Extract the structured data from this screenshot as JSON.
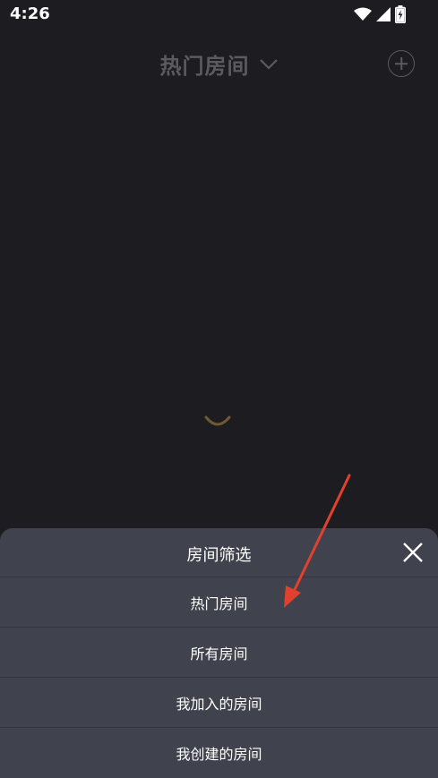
{
  "status_bar": {
    "time": "4:26",
    "icons": [
      "wifi-icon",
      "signal-icon",
      "battery-charging-icon"
    ]
  },
  "header": {
    "title": "热门房间",
    "dropdown_icon": "chevron-down-icon",
    "add_icon": "plus-circle-icon"
  },
  "loading": {
    "icon": "spinner-icon",
    "color": "#6b5a35"
  },
  "annotation": {
    "icon": "red-arrow-icon",
    "color": "#e0412e"
  },
  "sheet": {
    "title": "房间筛选",
    "close_icon": "close-icon",
    "options": [
      {
        "label": "热门房间"
      },
      {
        "label": "所有房间"
      },
      {
        "label": "我加入的房间"
      },
      {
        "label": "我创建的房间"
      }
    ]
  },
  "colors": {
    "background": "#1d1d21",
    "sheet": "#40424d",
    "divider": "#33353e",
    "header_text": "#5a5a5f"
  }
}
